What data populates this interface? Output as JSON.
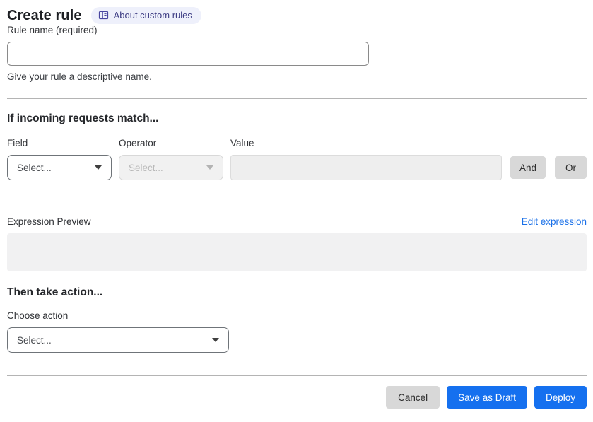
{
  "header": {
    "title": "Create rule",
    "badge": {
      "label": "About custom rules",
      "icon": "book-icon"
    }
  },
  "rule_name": {
    "label": "Rule name (required)",
    "value": "",
    "helper": "Give your rule a descriptive name."
  },
  "match_section": {
    "heading": "If incoming requests match...",
    "field": {
      "label": "Field",
      "value": "Select...",
      "enabled": true
    },
    "operator": {
      "label": "Operator",
      "value": "Select...",
      "enabled": false
    },
    "value": {
      "label": "Value",
      "value": "",
      "enabled": false
    },
    "and_label": "And",
    "or_label": "Or"
  },
  "expression": {
    "label": "Expression Preview",
    "edit_link": "Edit expression",
    "content": ""
  },
  "action_section": {
    "heading": "Then take action...",
    "choose_label": "Choose action",
    "value": "Select..."
  },
  "footer": {
    "cancel": "Cancel",
    "save_draft": "Save as Draft",
    "deploy": "Deploy"
  },
  "colors": {
    "primary_blue": "#1570ef",
    "link_blue": "#1a70e8",
    "badge_bg": "#eef0fb",
    "badge_text": "#3c3b83",
    "disabled_bg": "#f1f1f1",
    "gray_button": "#d8d8d8",
    "divider": "#b4b4b4"
  }
}
